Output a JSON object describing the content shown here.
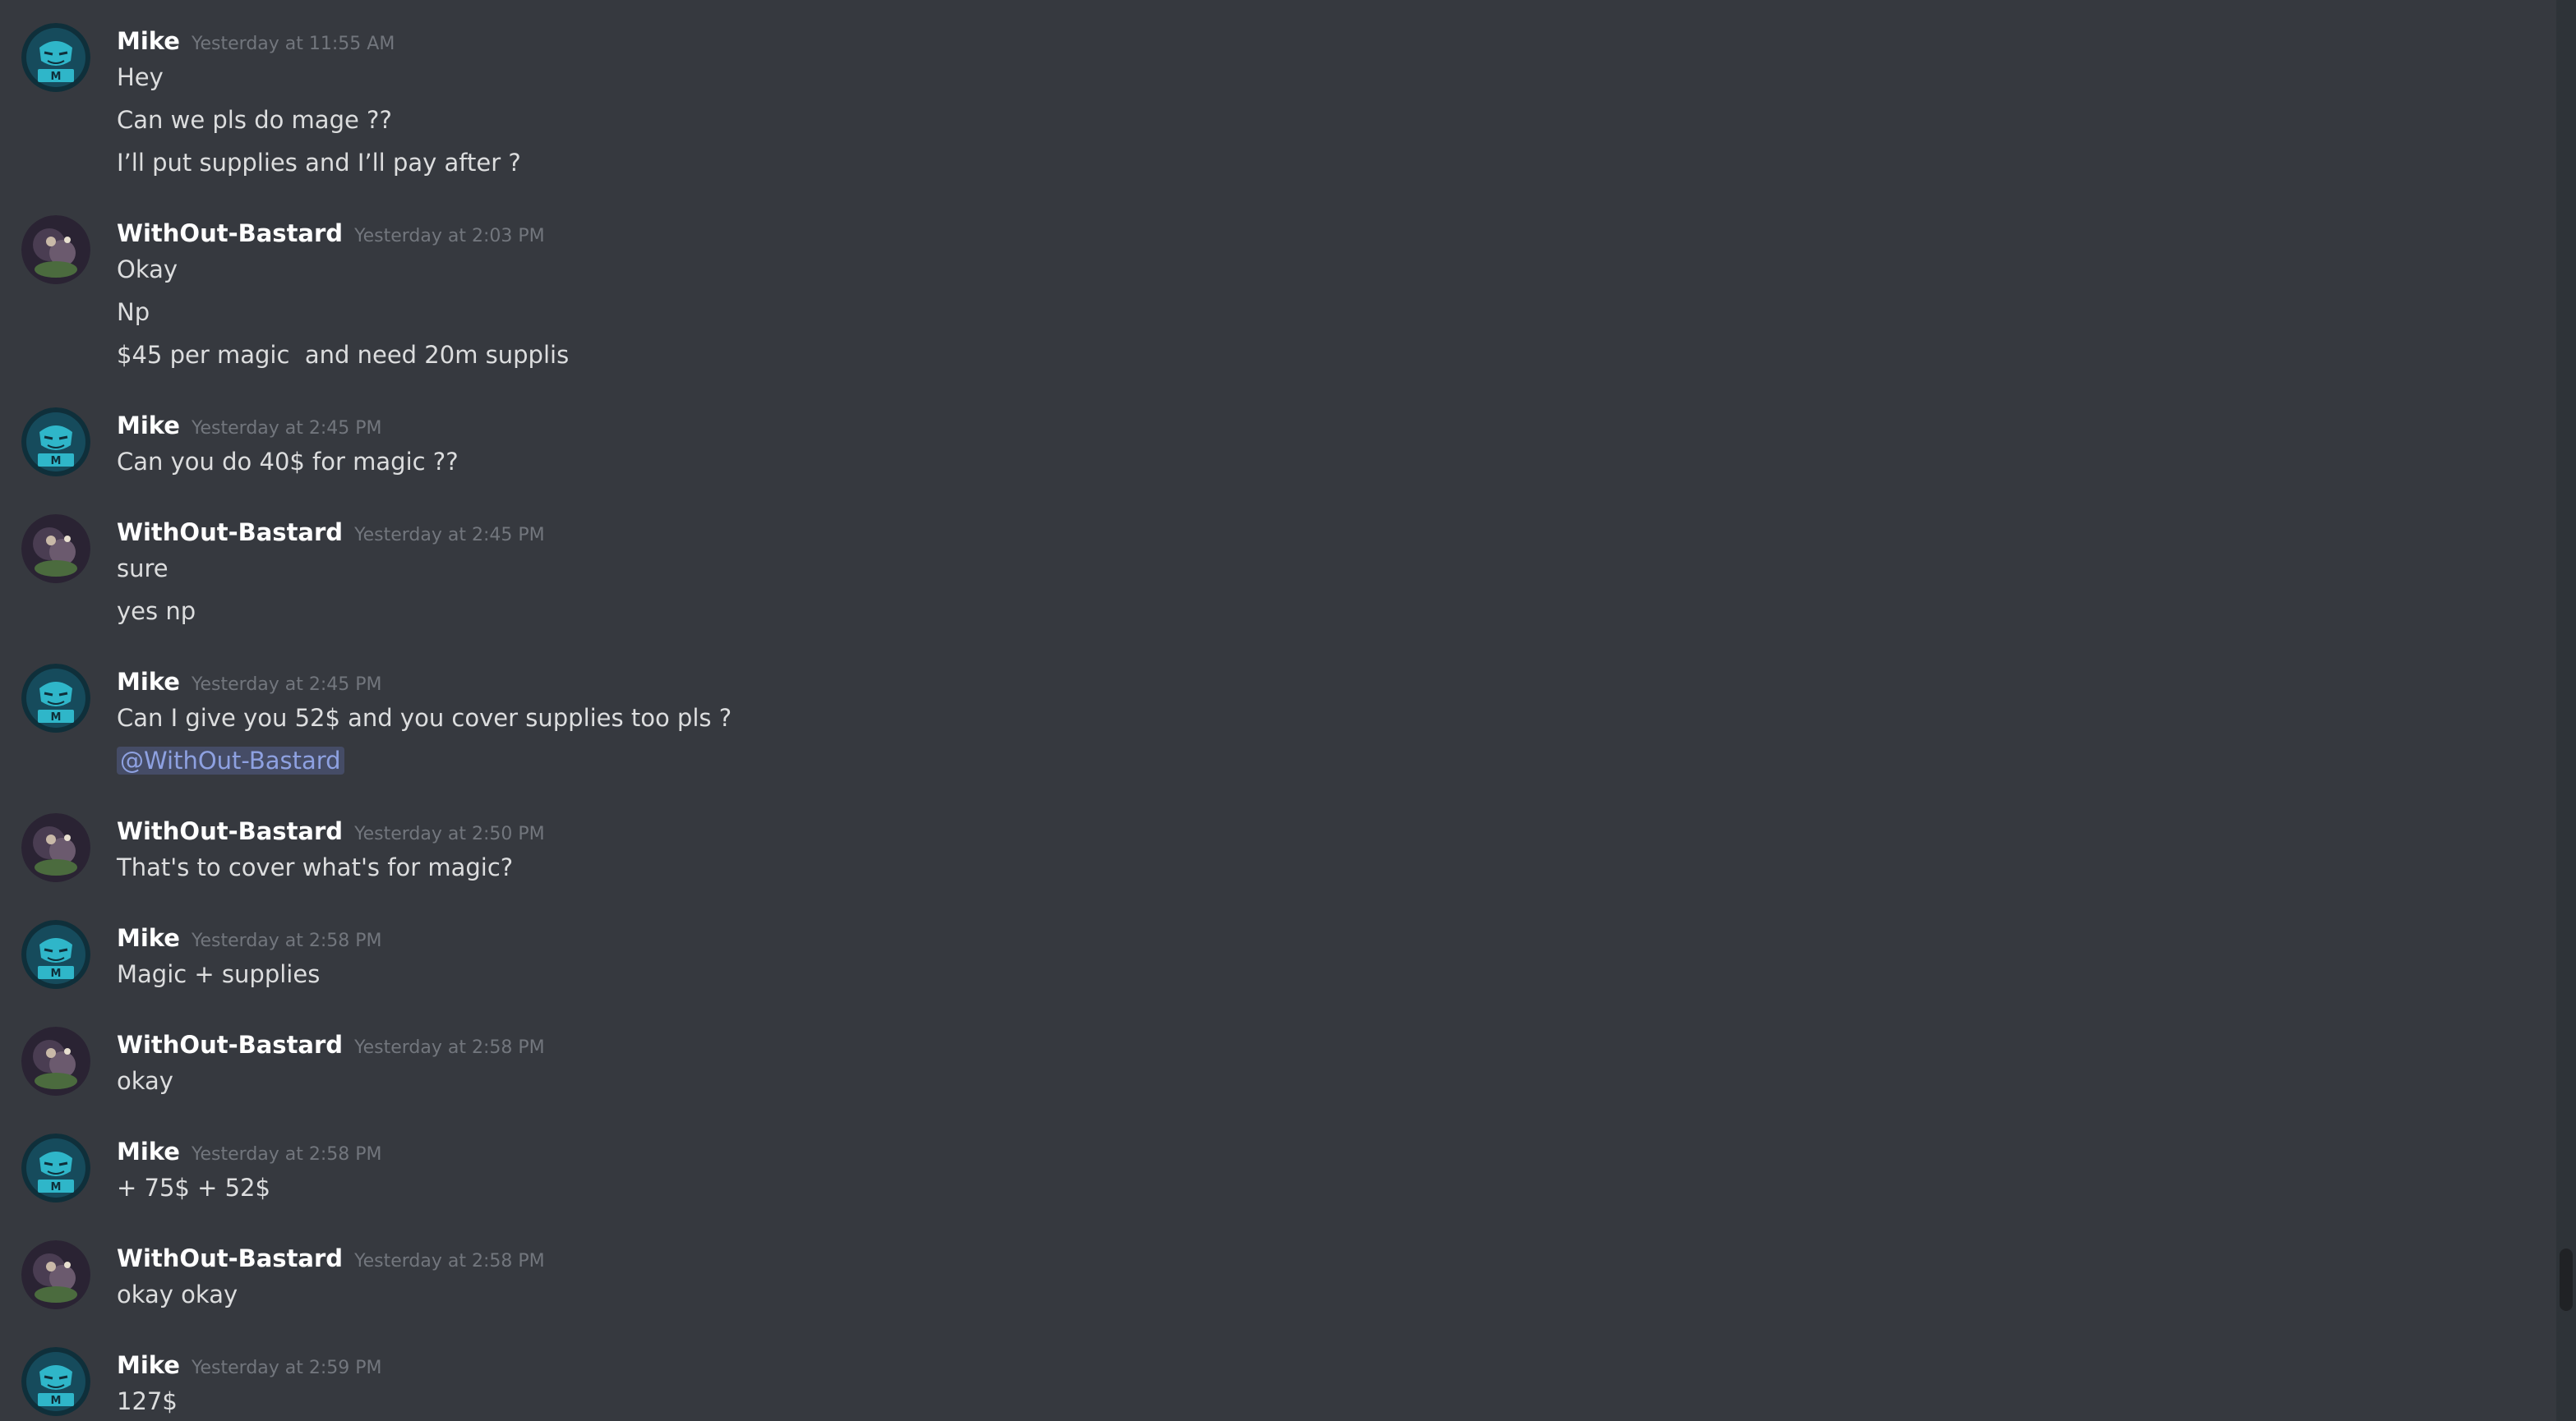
{
  "users": {
    "mike": {
      "name": "Mike"
    },
    "wob": {
      "name": "WithOut-Bastard"
    }
  },
  "colors": {
    "background": "#36393f",
    "username": "#ffffff",
    "timestamp": "#72767d",
    "message": "#dcddde",
    "mention": "#8ea1e1"
  },
  "messages": [
    {
      "author": "Mike",
      "time": "Yesterday at 11:55 AM",
      "lines": [
        "Hey",
        "Can we pls do mage ??",
        "I’ll put supplies and I’ll pay after ?"
      ]
    },
    {
      "author": "WithOut-Bastard",
      "time": "Yesterday at 2:03 PM",
      "lines": [
        "Okay",
        "Np",
        "$45 per magic  and need 20m supplis"
      ]
    },
    {
      "author": "Mike",
      "time": "Yesterday at 2:45 PM",
      "lines": [
        "Can you do 40$ for magic ??"
      ]
    },
    {
      "author": "WithOut-Bastard",
      "time": "Yesterday at 2:45 PM",
      "lines": [
        "sure",
        "yes np"
      ]
    },
    {
      "author": "Mike",
      "time": "Yesterday at 2:45 PM",
      "lines": [
        "Can I give you 52$ and you cover supplies too pls ?",
        "@WithOut-Bastard"
      ]
    },
    {
      "author": "WithOut-Bastard",
      "time": "Yesterday at 2:50 PM",
      "lines": [
        "That's to cover what's for magic?"
      ]
    },
    {
      "author": "Mike",
      "time": "Yesterday at 2:58 PM",
      "lines": [
        "Magic + supplies"
      ]
    },
    {
      "author": "WithOut-Bastard",
      "time": "Yesterday at 2:58 PM",
      "lines": [
        "okay"
      ]
    },
    {
      "author": "Mike",
      "time": "Yesterday at 2:58 PM",
      "lines": [
        "+ 75$ + 52$"
      ]
    },
    {
      "author": "WithOut-Bastard",
      "time": "Yesterday at 2:58 PM",
      "lines": [
        "okay okay"
      ]
    },
    {
      "author": "Mike",
      "time": "Yesterday at 2:59 PM",
      "lines": [
        "127$"
      ]
    }
  ]
}
